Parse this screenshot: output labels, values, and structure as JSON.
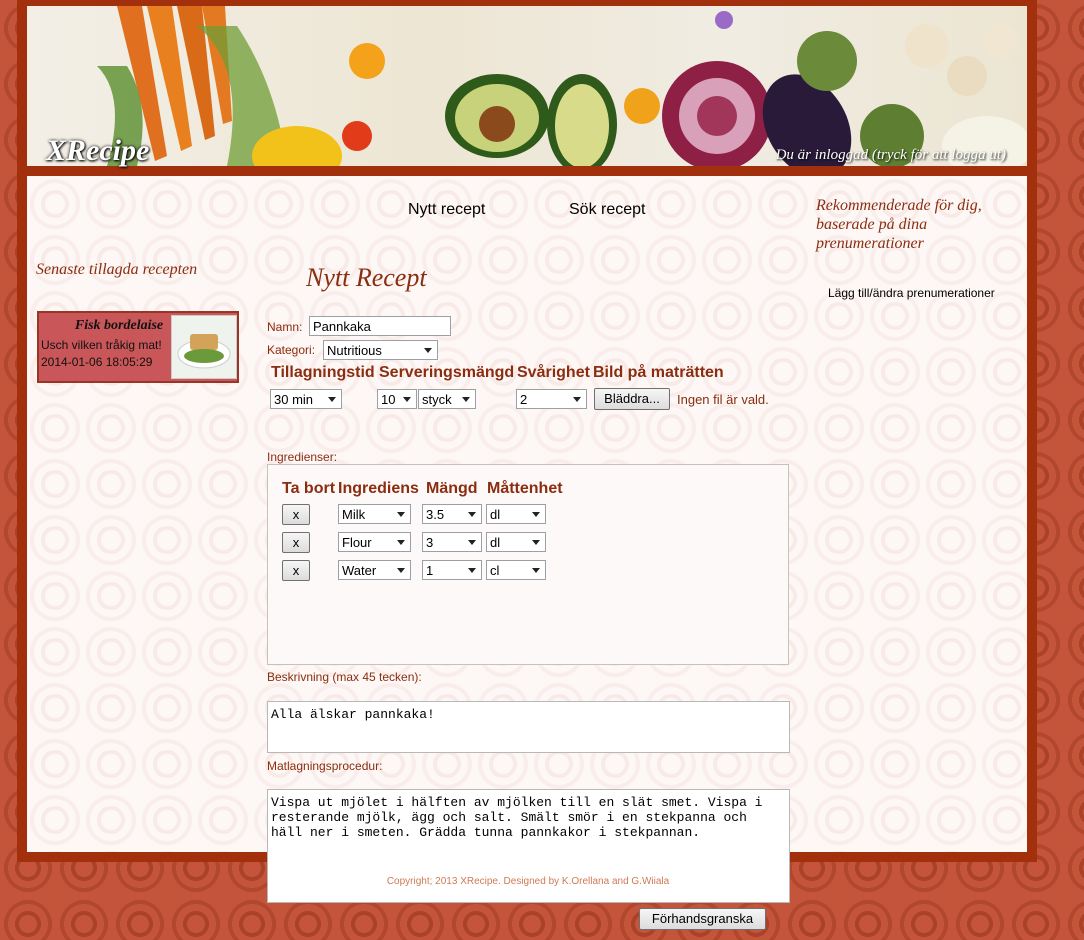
{
  "header": {
    "logo": "XRecipe",
    "login_status": "Du är inloggad (tryck för att logga ut)"
  },
  "nav": {
    "new_recipe": "Nytt recept",
    "search_recipe": "Sök recept"
  },
  "left_sidebar": {
    "title": "Senaste tillagda recepten",
    "recipes": [
      {
        "title": "Fisk bordelaise",
        "description": "Usch vilken tråkig mat!",
        "date": "2014-01-06 18:05:29"
      }
    ]
  },
  "right_sidebar": {
    "title": "Rekommenderade för dig, baserade på dina prenumerationer",
    "subscriptions_link": "Lägg till/ändra prenumerationer"
  },
  "form": {
    "page_title": "Nytt Recept",
    "name_label": "Namn:",
    "name_value": "Pannkaka",
    "category_label": "Kategori:",
    "category_value": "Nutritious",
    "headers": {
      "cook_time": "Tillagningstid",
      "servings": "Serveringsmängd",
      "difficulty": "Svårighet",
      "image": "Bild på maträtten"
    },
    "cook_time_value": "30 min",
    "servings_value": "10",
    "servings_unit": "styck",
    "difficulty_value": "2",
    "browse_button": "Bläddra...",
    "no_file": "Ingen fil är vald.",
    "ingredients_label": "Ingredienser:",
    "ingredient_headers": {
      "remove": "Ta bort",
      "ingredient": "Ingrediens",
      "amount": "Mängd",
      "unit": "Måttenhet"
    },
    "ingredients": [
      {
        "remove": "x",
        "name": "Milk",
        "amount": "3.5",
        "unit": "dl"
      },
      {
        "remove": "x",
        "name": "Flour",
        "amount": "3",
        "unit": "dl"
      },
      {
        "remove": "x",
        "name": "Water",
        "amount": "1",
        "unit": "cl"
      }
    ],
    "description_label": "Beskrivning (max 45 tecken):",
    "description_value": "Alla älskar pannkaka!",
    "procedure_label": "Matlagningsprocedur:",
    "procedure_value": "Vispa ut mjölet i hälften av mjölken till en slät smet. Vispa i\nresterande mjölk, ägg och salt. Smält smör i en stekpanna och\nhäll ner i smeten. Grädda tunna pannkakor i stekpannan.",
    "preview_button": "Förhandsgranska"
  },
  "footer": {
    "copyright": "Copyright; 2013 XRecipe. Designed by K.Orellana and G.Wiiala"
  }
}
